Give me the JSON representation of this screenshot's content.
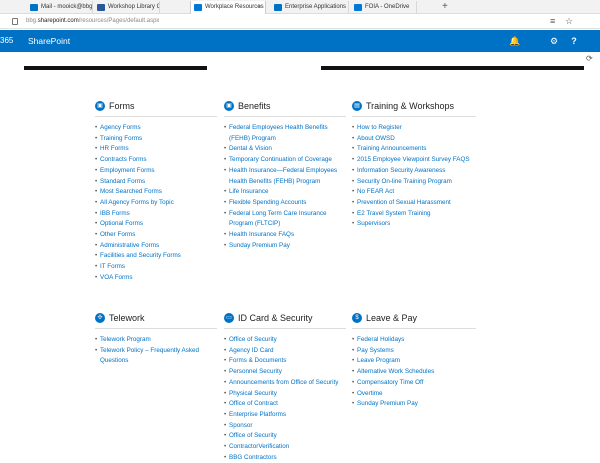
{
  "browser": {
    "tabs": [
      {
        "label": "Mail - mooick@bbg.gov",
        "color": "#0072c6",
        "active": false
      },
      {
        "label": "Workshop Library On-Dema",
        "color": "#2b579a",
        "active": false
      },
      {
        "label": "Workplace Resources",
        "color": "#0078d7",
        "active": true
      },
      {
        "label": "Enterprise Applications Lim",
        "color": "#0072c6",
        "active": false
      },
      {
        "label": "FOIA - OneDrive",
        "color": "#0078d7",
        "active": false
      }
    ],
    "new_tab_icon": "+",
    "url_pre": "bbg.",
    "url_domain": "sharepoint.com",
    "url_post": "/resources/Pages/default.aspx",
    "reading_icon": "≡",
    "favorite_icon": "☆"
  },
  "suitebar": {
    "o365": "365",
    "app": "SharePoint",
    "bell_icon": "🔔",
    "gear_icon": "⚙",
    "help_icon": "?"
  },
  "sync_icon": "⟳",
  "sections": [
    {
      "title": "Forms",
      "icon": "forms-icon",
      "glyph": "▣",
      "links": [
        "Agency Forms",
        "Training Forms",
        "HR Forms",
        "Contracts Forms",
        "Employment Forms",
        "Standard Forms",
        "Most Searched Forms",
        "All Agency Forms by Topic",
        "IBB Forms",
        "Optional Forms",
        "Other Forms",
        "Administrative Forms",
        "Facilities and Security Forms",
        "IT Forms",
        "VOA Forms"
      ]
    },
    {
      "title": "Benefits",
      "icon": "benefits-icon",
      "glyph": "▣",
      "links": [
        "Federal Employees Health Benefits (FEHB) Program",
        "Dental & Vision",
        "Temporary Continuation of Coverage",
        "Health Insurance—Federal Employees Health Benefits (FEHB) Program",
        "Life Insurance",
        "Flexible Spending Accounts",
        "Federal Long Term Care Insurance Program (FLTCIP)",
        "Health Insurance FAQs",
        "Sunday Premium Pay"
      ]
    },
    {
      "title": "Training & Workshops",
      "icon": "training-icon",
      "glyph": "▤",
      "links": [
        "How to Register",
        "About OWSD",
        "Training Announcements",
        "2015 Employee Viewpoint Survey FAQS",
        "Information Security Awareness",
        "Security On-line Training Program",
        "No FEAR Act",
        "Prevention of Sexual Harassment",
        "E2 Travel System Training",
        "Supervisors"
      ]
    },
    {
      "title": "Telework",
      "icon": "telework-icon",
      "glyph": "✣",
      "links": [
        "Telework Program",
        "Telework Policy – Frequently Asked Questions"
      ]
    },
    {
      "title": "ID Card & Security",
      "icon": "id-card-icon",
      "glyph": "▭",
      "links": [
        "Office of Security",
        "Agency ID Card",
        "Forms & Documents",
        "Personnel Security",
        "Announcements from Office of Security",
        "Physical Security",
        "Office of Contract",
        "Enterprise Platforms",
        "Sponsor",
        "Office of Security",
        "ContractorVerification",
        "BBG Contractors"
      ]
    },
    {
      "title": "Leave & Pay",
      "icon": "leave-pay-icon",
      "glyph": "$",
      "links": [
        "Federal Holidays",
        "Pay Systems",
        "Leave Program",
        "Alternative Work Schedules",
        "Compensatory Time Off",
        "Overtime",
        "Sunday Premium Pay"
      ]
    }
  ]
}
